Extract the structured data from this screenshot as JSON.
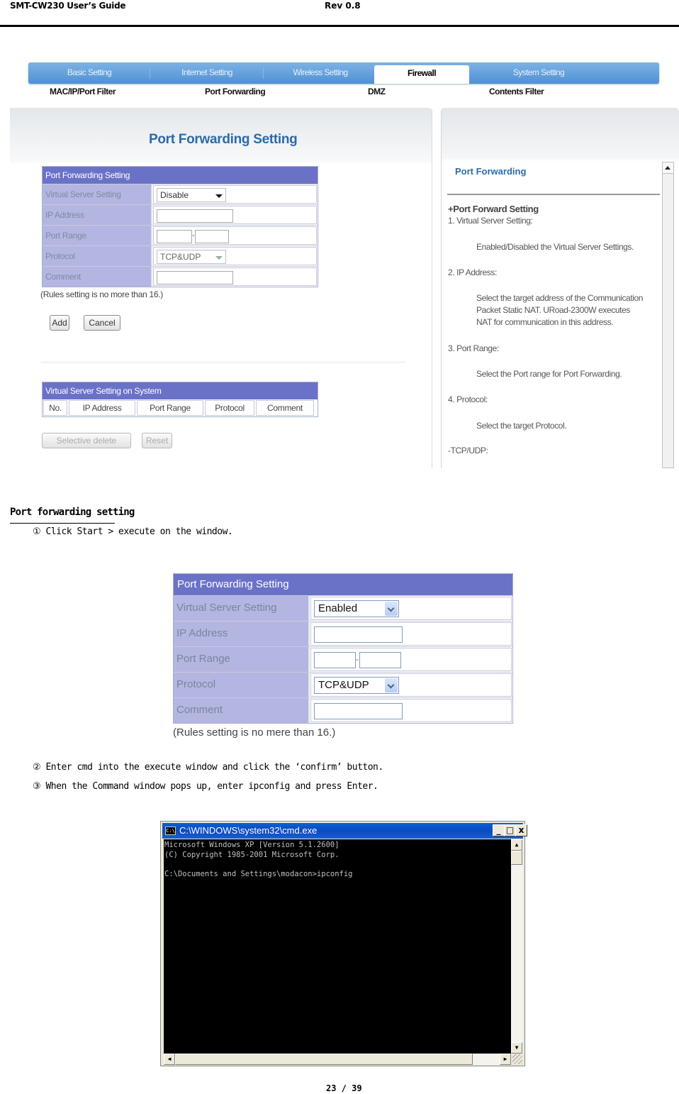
{
  "doc_header": {
    "title": "SMT-CW230 User’s Guide",
    "revision": "Rev 0.8"
  },
  "router_ui": {
    "nav_tabs": [
      {
        "label": "Basic Setting",
        "active": false
      },
      {
        "label": "Internet Setting",
        "active": false
      },
      {
        "label": "Wireless Setting",
        "active": false
      },
      {
        "label": "Firewall",
        "active": true
      },
      {
        "label": "System Setting",
        "active": false
      }
    ],
    "sub_nav": [
      "MAC/IP/Port Filter",
      "Port Forwarding",
      "DMZ",
      "Contents Filter"
    ],
    "page_title": "Port Forwarding Setting",
    "form": {
      "header": "Port Forwarding Setting",
      "rows": {
        "virtual_server_label": "Virtual Server Setting",
        "virtual_server_value": "Disable",
        "ip_label": "IP Address",
        "ip_value": "",
        "port_range_label": "Port Range",
        "port_from": "",
        "port_to": "",
        "protocol_label": "Protocol",
        "protocol_value": "TCP&UDP",
        "comment_label": "Comment",
        "comment_value": ""
      },
      "note": "(Rules setting is no more than 16.)",
      "add_label": "Add",
      "cancel_label": "Cancel"
    },
    "system_table": {
      "header": "Virtual Server Setting on System",
      "columns": [
        "No.",
        "IP Address",
        "Port Range",
        "Protocol",
        "Comment"
      ],
      "selective_delete_label": "Selective delete",
      "reset_label": "Reset"
    },
    "help": {
      "title": "Port Forwarding",
      "section": "+Port Forward Setting",
      "items": [
        {
          "heading": "1. Virtual Server Setting:",
          "body": [
            "Enabled/Disabled the Virtual Server Settings."
          ]
        },
        {
          "heading": "2. IP Address:",
          "body": [
            "Select the target address of the Communication",
            "Packet Static NAT. URoad-2300W executes",
            "NAT for communication in this address."
          ]
        },
        {
          "heading": "3. Port Range:",
          "body": [
            "Select the Port range for Port Forwarding."
          ]
        },
        {
          "heading": "4. Protocol:",
          "body": [
            "Select the target Protocol."
          ]
        },
        {
          "heading": "-TCP/UDP:",
          "body": []
        }
      ]
    }
  },
  "section": {
    "title": "Port forwarding setting",
    "steps": [
      "① Click Start > execute on the window.",
      "② Enter cmd into the execute window and click the  ‘confirm’  button.",
      "③ When the Command window pops up, enter ipconfig and press Enter."
    ]
  },
  "form_zoom": {
    "header": "Port Forwarding Setting",
    "virtual_server_label": "Virtual Server Setting",
    "virtual_server_value": "Enabled",
    "ip_label": "IP Address",
    "port_range_label": "Port Range",
    "protocol_label": "Protocol",
    "protocol_value": "TCP&UDP",
    "comment_label": "Comment",
    "note": "(Rules setting is no mere than 16.)"
  },
  "cmd_window": {
    "title": "C:\\WINDOWS\\system32\\cmd.exe",
    "icon_text": "C:\\",
    "lines": [
      "Microsoft Windows XP [Version 5.1.2600]",
      "(C) Copyright 1985-2001 Microsoft Corp.",
      "",
      "C:\\Documents and Settings\\modacon>ipconfig"
    ]
  },
  "footer": {
    "page": "23 / 39"
  }
}
